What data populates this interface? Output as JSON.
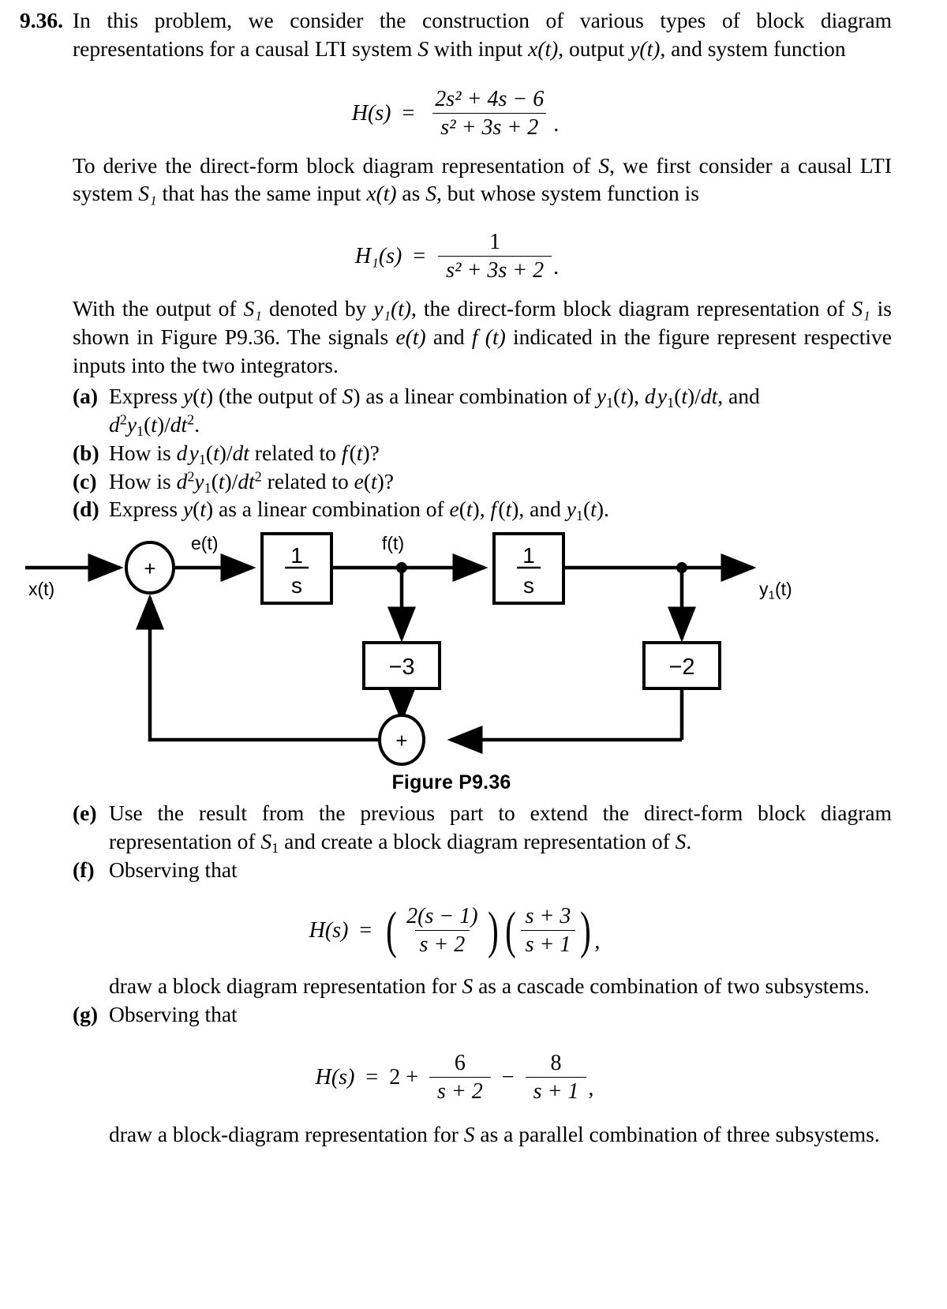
{
  "problem": {
    "number": "9.36.",
    "intro_line1": "In this problem, we consider the construction of various types of block diagram",
    "intro_line2_a": "representations for a causal LTI system ",
    "intro_S": "S",
    "intro_line2_b": " with input ",
    "intro_x": "x(t)",
    "intro_line2_c": ", output ",
    "intro_y": "y(t)",
    "intro_line2_d": ", and system",
    "intro_line3": "function"
  },
  "equations": {
    "H_main": {
      "lhs": "H(s)",
      "equals": "=",
      "numerator": "2s² + 4s − 6",
      "denominator": "s² + 3s + 2",
      "trailing": "."
    },
    "H1": {
      "lhs": "H₁(s)",
      "equals": "=",
      "numerator": "1",
      "denominator": "s² + 3s + 2",
      "trailing": "."
    },
    "H_cascade": {
      "lhs": "H(s)",
      "equals": "=",
      "factor1_num": "2(s − 1)",
      "factor1_den": "s + 2",
      "factor2_num": "s + 3",
      "factor2_den": "s + 1",
      "trailing": ","
    },
    "H_parallel": {
      "lhs": "H(s)",
      "equals": "=",
      "constant": "2 +",
      "term1_num": "6",
      "term1_den": "s + 2",
      "minus": "−",
      "term2_num": "8",
      "term2_den": "s + 1",
      "trailing": ","
    }
  },
  "paragraphs": {
    "derive_a": "To derive the direct-form block diagram representation of ",
    "derive_S": "S",
    "derive_b": ", we first consider a causal LTI system ",
    "derive_S1": "S₁",
    "derive_c": " that has the same input ",
    "derive_x": "x(t)",
    "derive_d": " as ",
    "derive_e": ", but whose system function is",
    "with_output_a": "With the output of ",
    "with_output_S1": "S₁",
    "with_output_b": " denoted by ",
    "with_output_y1": "y₁(t)",
    "with_output_c": ", the direct-form block diagram representation of ",
    "with_output_d": " is shown in Figure P9.36. The signals ",
    "with_output_e": "e(t)",
    "with_output_f": " and ",
    "with_output_g": "f (t)",
    "with_output_h": " indicated in the figure represent respective inputs into the two integrators."
  },
  "parts": [
    {
      "label": "(a)",
      "text": "Express y(t) (the output of S) as a linear combination of y₁(t), dy₁(t)/dt, and d²y₁(t)/dt²."
    },
    {
      "label": "(b)",
      "text": "How is dy₁(t)/dt related to f (t)?"
    },
    {
      "label": "(c)",
      "text": "How is d²y₁(t)/dt² related to e(t)?"
    },
    {
      "label": "(d)",
      "text": "Express y(t) as a linear combination of e(t), f (t), and y₁(t)."
    },
    {
      "label": "(e)",
      "text": "Use the result from the previous part to extend the direct-form block diagram representation of S₁ and create a block diagram representation of S."
    },
    {
      "label": "(f)",
      "text": "Observing that",
      "after": "draw a block diagram representation for S as a cascade combination of two subsystems."
    },
    {
      "label": "(g)",
      "text": "Observing that",
      "after": "draw a block-diagram representation for S as a parallel combination of three subsystems."
    }
  ],
  "figure": {
    "caption": "Figure P9.36",
    "labels": {
      "input": "x(t)",
      "sum_top": "+",
      "signal_e": "e(t)",
      "integrator1_num": "1",
      "integrator1_den": "s",
      "signal_f": "f(t)",
      "integrator2_num": "1",
      "integrator2_den": "s",
      "output": "y₁(t)",
      "gain1": "−3",
      "gain2": "−2",
      "sum_bottom": "+"
    },
    "colors": {
      "line": "#000000",
      "fill": "#ffffff"
    }
  }
}
